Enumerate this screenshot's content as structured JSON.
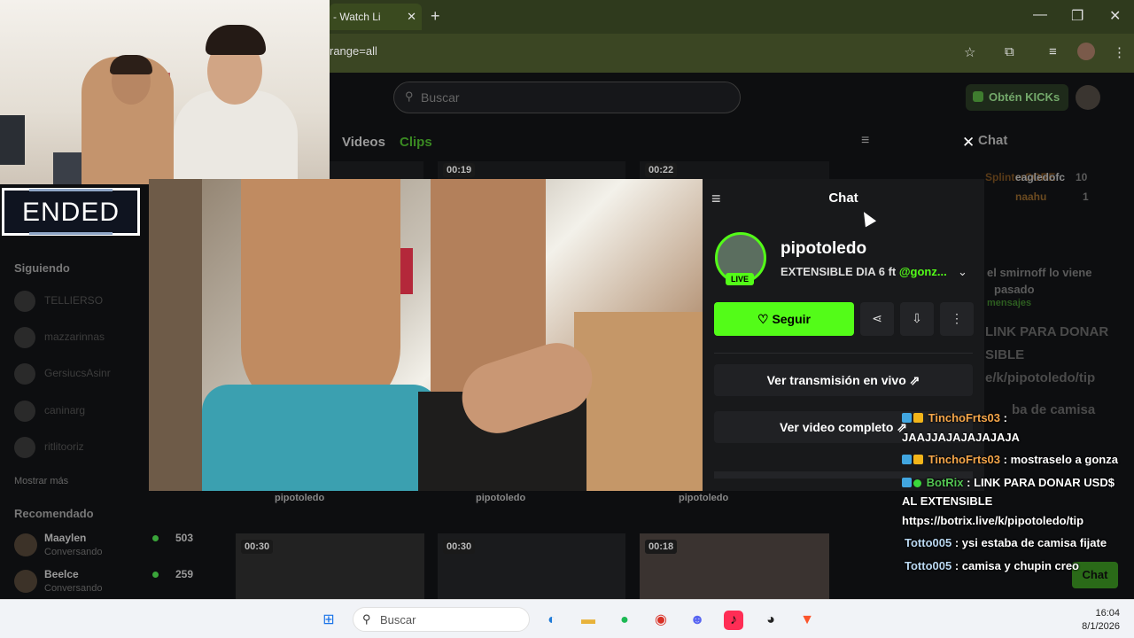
{
  "browser": {
    "tab_title": "- Watch Li",
    "url": "range=all"
  },
  "page": {
    "search_placeholder": "Buscar",
    "kicks_label": "Obtén KICKs",
    "tabs": [
      "Videos",
      "Clips"
    ],
    "bg_chat_label": "Chat",
    "clip_durations_top": [
      "00:19",
      "00:22"
    ],
    "clip_durations_bottom": [
      "00:30",
      "00:30",
      "00:18"
    ],
    "clip_channel_labels": [
      "pipotoledo",
      "pipotoledo",
      "pipotoledo"
    ],
    "bg_bottom_chat_button": "Chat"
  },
  "sidebar": {
    "following_heading": "Siguiendo",
    "following": [
      "TELLIERSO",
      "mazzarinnas",
      "GersiucsAsinr",
      "caninarg",
      "ritlitooriz"
    ],
    "show_more": "Mostrar más",
    "recommended_heading": "Recomendado",
    "recommended": [
      {
        "name": "Maaylen",
        "category": "Conversando",
        "viewers": "503"
      },
      {
        "name": "Beelce",
        "category": "Conversando",
        "viewers": "259"
      }
    ]
  },
  "overlay_status": "ENDED",
  "popup": {
    "title": "Chat",
    "channel_name": "pipotoledo",
    "live_badge": "LIVE",
    "stream_title": "EXTENSIBLE DIA 6 ft ",
    "stream_title_mention": "@gonz...",
    "follow_label": "Seguir",
    "watch_live_label": "Ver transmisión en vivo",
    "full_video_label": "Ver video completo"
  },
  "bg_chat_fragments": {
    "users": [
      "SplinterCORE",
      "eagledofc",
      "naahu"
    ],
    "counts": [
      "10",
      "1"
    ],
    "msg_line1": "el smirnoff lo viene",
    "msg_line2": "pasado",
    "messages_label": "mensajes",
    "link_line1": "LINK PARA DONAR",
    "link_line2": "SIBLE",
    "link_line3": "e/k/pipotoledo/tip",
    "camisa_line": "ba de camisa"
  },
  "chat_overlay": [
    {
      "user": "TinchoFrts03",
      "text": " :"
    },
    {
      "user": "",
      "text": "JAAJJAJAJAJAJAJA"
    },
    {
      "user": "TinchoFrts03",
      "text": " : mostraselo a gonza"
    },
    {
      "user": "BotRix",
      "text": " : LINK PARA DONAR USD$"
    },
    {
      "user": "",
      "text": "AL EXTENSIBLE"
    },
    {
      "user": "",
      "text": "https://botrix.live/k/pipotoledo/tip"
    },
    {
      "user": "Totto005",
      "text": " : ysi estaba de camisa fijate"
    },
    {
      "user": "Totto005",
      "text": " : camisa y chupin creo"
    }
  ],
  "taskbar": {
    "search_placeholder": "Buscar",
    "time": "16:04",
    "date": "8/1/2026"
  },
  "colors": {
    "kick_green": "#53fc18",
    "browser_frame": "#2f3a1d",
    "page_bg": "#0d0e10"
  }
}
